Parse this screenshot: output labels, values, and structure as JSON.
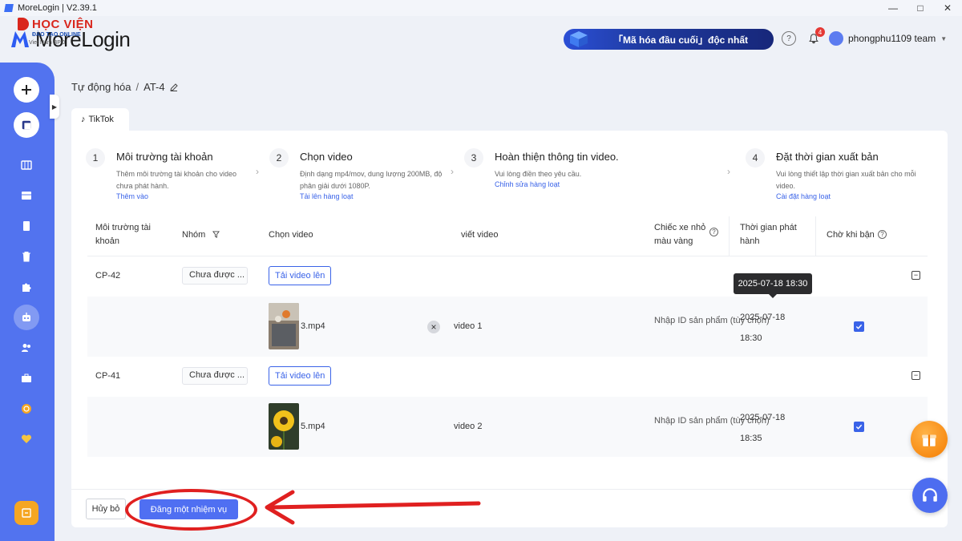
{
  "window": {
    "title": "MoreLogin | V2.39.1"
  },
  "watermark": {
    "line1": "HỌC VIỆN",
    "line2": "ĐÀO TẠO ONLINE",
    "line3": "Viet Nam BPO"
  },
  "brand": {
    "logo_text": "MoreLogin"
  },
  "header": {
    "promo_text": "「Mã hóa đầu cuối」độc nhất",
    "notification_count": "4",
    "team_name": "phongphu1109 team"
  },
  "breadcrumb": {
    "parent": "Tự động hóa",
    "separator": "/",
    "current": "AT-4"
  },
  "tab": {
    "label": "TikTok"
  },
  "steps": [
    {
      "num": "1",
      "title": "Môi trường tài khoản",
      "desc": "Thêm môi trường tài khoản cho video chưa phát hành.",
      "link": "Thêm vào"
    },
    {
      "num": "2",
      "title": "Chọn video",
      "desc": "Định dạng mp4/mov, dung lượng 200MB, độ phân giải dưới 1080P.",
      "link": "Tải lên hàng loạt"
    },
    {
      "num": "3",
      "title": "Hoàn thiện thông tin video.",
      "desc": "Vui lòng điền theo yêu cầu.",
      "link": "Chỉnh sửa hàng loạt"
    },
    {
      "num": "4",
      "title": "Đặt thời gian xuất bản",
      "desc": "Vui lòng thiết lập thời gian xuất bản cho mỗi video.",
      "link": "Cài đặt hàng loạt"
    }
  ],
  "table": {
    "headers": {
      "env": "Môi trường tài khoản",
      "group": "Nhóm",
      "video": "Chọn video",
      "title": "viết video",
      "product": "Chiếc xe nhỏ màu vàng",
      "time": "Thời gian phát hành",
      "wait": "Chờ khi bận"
    },
    "rows": [
      {
        "env": "CP-42",
        "group": "Chưa được ...",
        "upload": "Tải video lên",
        "file": "3.mp4",
        "title": "video 1",
        "product_id": "Nhập ID sản phẩm (tùy chọn)",
        "date": "2025-07-18",
        "time": "18:30",
        "wait_checked": true
      },
      {
        "env": "CP-41",
        "group": "Chưa được ...",
        "upload": "Tải video lên",
        "file": "5.mp4",
        "title": "video 2",
        "product_id": "Nhập ID sản phẩm (tùy chọn)",
        "date": "2025-07-18",
        "time": "18:35",
        "wait_checked": true
      }
    ]
  },
  "tooltip": {
    "text": "2025-07-18 18:30"
  },
  "footer": {
    "cancel": "Hủy bỏ",
    "submit": "Đăng một nhiệm vụ"
  },
  "colors": {
    "accent": "#4f6ff2",
    "sidebar": "#5273ef",
    "annotation": "#e02020"
  }
}
